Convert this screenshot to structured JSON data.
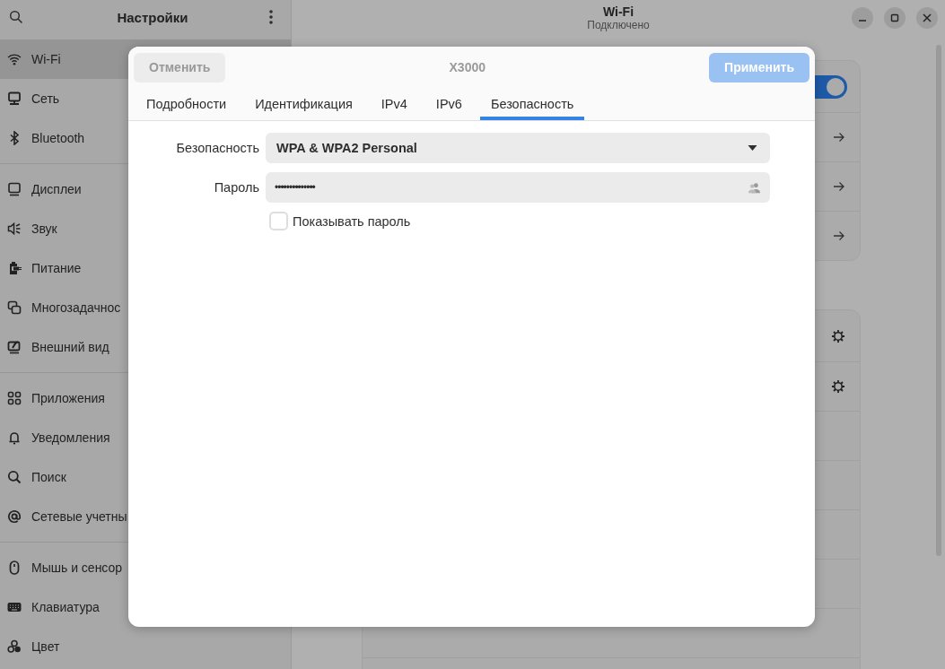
{
  "window": {
    "title": "Wi-Fi",
    "subtitle": "Подключено"
  },
  "sidebar": {
    "title": "Настройки",
    "groups": [
      {
        "items": [
          {
            "label": "Wi-Fi",
            "selected": true
          },
          {
            "label": "Сеть",
            "selected": false
          },
          {
            "label": "Bluetooth",
            "selected": false
          }
        ]
      },
      {
        "items": [
          {
            "label": "Дисплеи",
            "selected": false
          },
          {
            "label": "Звук",
            "selected": false
          },
          {
            "label": "Питание",
            "selected": false
          },
          {
            "label": "Многозадачнос",
            "selected": false
          },
          {
            "label": "Внешний вид",
            "selected": false
          }
        ]
      },
      {
        "items": [
          {
            "label": "Приложения",
            "selected": false
          },
          {
            "label": "Уведомления",
            "selected": false
          },
          {
            "label": "Поиск",
            "selected": false
          },
          {
            "label": "Сетевые учетны",
            "selected": false
          }
        ]
      },
      {
        "items": [
          {
            "label": "Мышь и сенсор",
            "selected": false
          },
          {
            "label": "Клавиатура",
            "selected": false
          },
          {
            "label": "Цвет",
            "selected": false
          }
        ]
      }
    ]
  },
  "top_card_rows": [
    {
      "kind": "switch",
      "on": true
    },
    {
      "kind": "link"
    },
    {
      "kind": "link"
    },
    {
      "kind": "link"
    }
  ],
  "network_rows": [
    {
      "kind": "settings"
    },
    {
      "kind": "settings"
    },
    {
      "kind": "plain"
    },
    {
      "kind": "plain"
    },
    {
      "kind": "plain"
    },
    {
      "kind": "plain"
    },
    {
      "kind": "plain"
    },
    {
      "kind": "plain"
    }
  ],
  "dialog": {
    "title": "X3000",
    "cancel": {
      "label": "Отменить",
      "disabled": true
    },
    "apply": {
      "label": "Применить",
      "disabled": true
    },
    "tabs": [
      {
        "label": "Подробности",
        "selected": false
      },
      {
        "label": "Идентификация",
        "selected": false
      },
      {
        "label": "IPv4",
        "selected": false
      },
      {
        "label": "IPv6",
        "selected": false
      },
      {
        "label": "Безопасность",
        "selected": true
      }
    ],
    "security": {
      "label": "Безопасность",
      "value": "WPA & WPA2 Personal"
    },
    "password": {
      "label": "Пароль",
      "value": "••••••••••••••"
    },
    "show_password": {
      "label": "Показывать пароль",
      "checked": false
    }
  }
}
